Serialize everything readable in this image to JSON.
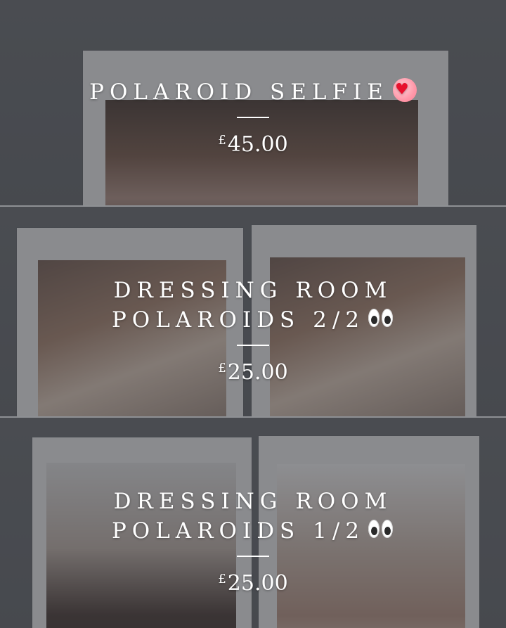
{
  "products": [
    {
      "title": "POLAROID SELFIE",
      "emoji_icon": "heart-icon",
      "price_currency": "£",
      "price_amount": "45.00"
    },
    {
      "title": "DRESSING ROOM POLAROIDS 2/2",
      "emoji_icon": "eyes-icon",
      "price_currency": "£",
      "price_amount": "25.00"
    },
    {
      "title": "DRESSING ROOM POLAROIDS 1/2",
      "emoji_icon": "eyes-icon",
      "price_currency": "£",
      "price_amount": "25.00"
    }
  ]
}
